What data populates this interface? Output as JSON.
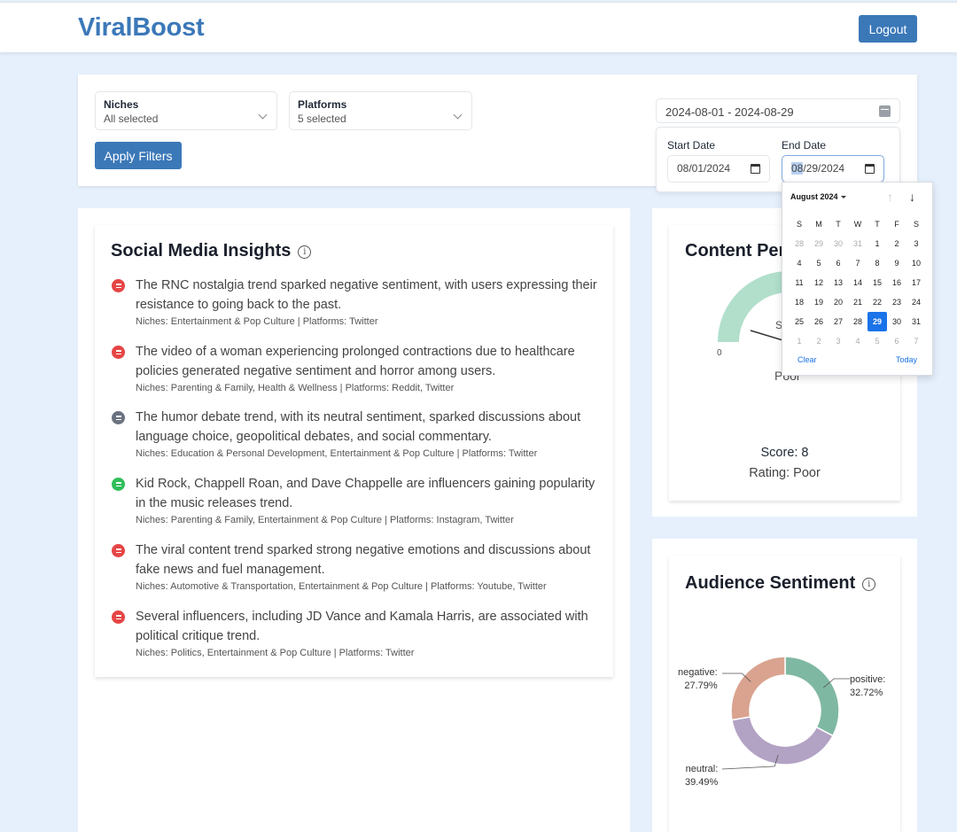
{
  "header": {
    "brand": "ViralBoost",
    "logout_label": "Logout"
  },
  "filters": {
    "niches": {
      "label": "Niches",
      "value": "All selected"
    },
    "platforms": {
      "label": "Platforms",
      "value": "5 selected"
    },
    "apply_label": "Apply Filters",
    "date_range": "2024-08-01 - 2024-08-29",
    "start_date": {
      "label": "Start Date",
      "value": "08/01/2024"
    },
    "end_date": {
      "label": "End Date",
      "month_part": "08",
      "rest": "/29/2024"
    }
  },
  "calendar": {
    "month_label": "August 2024",
    "weekdays": [
      "S",
      "M",
      "T",
      "W",
      "T",
      "F",
      "S"
    ],
    "days": [
      {
        "d": "28",
        "m": true
      },
      {
        "d": "29",
        "m": true
      },
      {
        "d": "30",
        "m": true
      },
      {
        "d": "31",
        "m": true
      },
      {
        "d": "1"
      },
      {
        "d": "2"
      },
      {
        "d": "3"
      },
      {
        "d": "4"
      },
      {
        "d": "5"
      },
      {
        "d": "6"
      },
      {
        "d": "7"
      },
      {
        "d": "8"
      },
      {
        "d": "9"
      },
      {
        "d": "10"
      },
      {
        "d": "11"
      },
      {
        "d": "12"
      },
      {
        "d": "13"
      },
      {
        "d": "14"
      },
      {
        "d": "15"
      },
      {
        "d": "16"
      },
      {
        "d": "17"
      },
      {
        "d": "18"
      },
      {
        "d": "19"
      },
      {
        "d": "20"
      },
      {
        "d": "21"
      },
      {
        "d": "22"
      },
      {
        "d": "23"
      },
      {
        "d": "24"
      },
      {
        "d": "25"
      },
      {
        "d": "26"
      },
      {
        "d": "27"
      },
      {
        "d": "28"
      },
      {
        "d": "29",
        "sel": true
      },
      {
        "d": "30"
      },
      {
        "d": "31"
      },
      {
        "d": "1",
        "m": true
      },
      {
        "d": "2",
        "m": true
      },
      {
        "d": "3",
        "m": true
      },
      {
        "d": "4",
        "m": true
      },
      {
        "d": "5",
        "m": true
      },
      {
        "d": "6",
        "m": true
      },
      {
        "d": "7",
        "m": true
      }
    ],
    "clear_label": "Clear",
    "today_label": "Today",
    "selected_color": "#1a73e8"
  },
  "insights": {
    "title": "Social Media Insights",
    "items": [
      {
        "sentiment": "negative",
        "text": "The RNC nostalgia trend sparked negative sentiment, with users expressing their resistance to going back to the past.",
        "meta": "Niches: Entertainment & Pop Culture | Platforms: Twitter"
      },
      {
        "sentiment": "negative",
        "text": "The video of a woman experiencing prolonged contractions due to healthcare policies generated negative sentiment and horror among users.",
        "meta": "Niches: Parenting & Family, Health & Wellness | Platforms: Reddit, Twitter"
      },
      {
        "sentiment": "neutral",
        "text": "The humor debate trend, with its neutral sentiment, sparked discussions about language choice, geopolitical debates, and social commentary.",
        "meta": "Niches: Education & Personal Development, Entertainment & Pop Culture | Platforms: Twitter"
      },
      {
        "sentiment": "positive",
        "text": "Kid Rock, Chappell Roan, and Dave Chappelle are influencers gaining popularity in the music releases trend.",
        "meta": "Niches: Parenting & Family, Entertainment & Pop Culture | Platforms: Instagram, Twitter"
      },
      {
        "sentiment": "negative",
        "text": "The viral content trend sparked strong negative emotions and discussions about fake news and fuel management.",
        "meta": "Niches: Automotive & Transportation, Entertainment & Pop Culture | Platforms: Youtube, Twitter"
      },
      {
        "sentiment": "negative",
        "text": "Several influencers, including JD Vance and Kamala Harris, are associated with political critique trend.",
        "meta": "Niches: Politics, Entertainment & Pop Culture | Platforms: Twitter"
      }
    ]
  },
  "performance": {
    "title": "Content Performance",
    "gauge_min_label": "0",
    "gauge_center_label_partial": "S",
    "gauge_rating_label": "Poor",
    "score_text": "Score: 8",
    "rating_text": "Rating: Poor",
    "gauge_color": "#a8dcc6"
  },
  "chart_data": {
    "type": "pie",
    "title": "Audience Sentiment",
    "donut": true,
    "slices": [
      {
        "label": "positive",
        "value": 32.72,
        "display": "32.72%",
        "color": "#7fb8a2"
      },
      {
        "label": "neutral",
        "value": 39.49,
        "display": "39.49%",
        "color": "#b2a2c4"
      },
      {
        "label": "negative",
        "value": 27.79,
        "display": "27.79%",
        "color": "#d9a38f"
      }
    ]
  }
}
